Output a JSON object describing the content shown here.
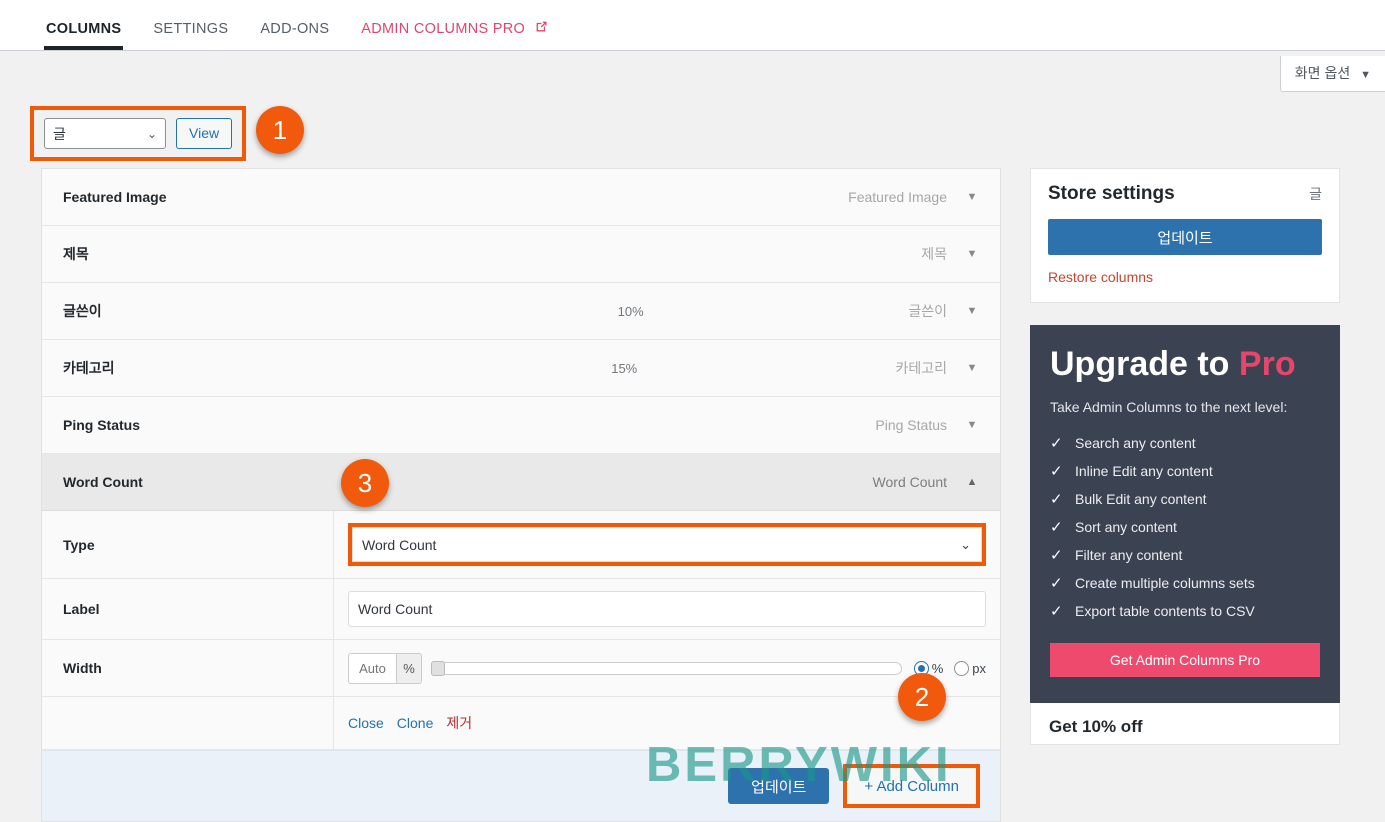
{
  "tabs": [
    {
      "label": "COLUMNS",
      "active": true
    },
    {
      "label": "SETTINGS",
      "active": false
    },
    {
      "label": "ADD-ONS",
      "active": false
    },
    {
      "label": "ADMIN COLUMNS PRO",
      "active": false,
      "external": true
    }
  ],
  "screen_options": {
    "label": "화면 옵션",
    "caret": "▼"
  },
  "selector": {
    "post_type_value": "글",
    "view_button": "View",
    "dropdown_arrow": "⌄"
  },
  "badges": {
    "one": "1",
    "two": "2",
    "three": "3"
  },
  "columns": [
    {
      "label": "Featured Image",
      "width": "",
      "type": "Featured Image",
      "toggle": "▼",
      "expanded": false
    },
    {
      "label": "제목",
      "width": "",
      "type": "제목",
      "toggle": "▼",
      "expanded": false
    },
    {
      "label": "글쓴이",
      "width": "10%",
      "type": "글쓴이",
      "toggle": "▼",
      "expanded": false
    },
    {
      "label": "카테고리",
      "width": "15%",
      "type": "카테고리",
      "toggle": "▼",
      "expanded": false
    },
    {
      "label": "Ping Status",
      "width": "",
      "type": "Ping Status",
      "toggle": "▼",
      "expanded": false
    },
    {
      "label": "Word Count",
      "width": "",
      "type": "Word Count",
      "toggle": "▲",
      "expanded": true
    }
  ],
  "settings_form": {
    "type_label": "Type",
    "type_value": "Word Count",
    "type_arrow": "⌄",
    "label_label": "Label",
    "label_value": "Word Count",
    "label_placeholder": "Word Count",
    "width_label": "Width",
    "width_value": "Auto",
    "width_placeholder": "Auto",
    "width_unit": "%",
    "unit_percent": "%",
    "unit_px": "px",
    "selected_unit": "%",
    "links": {
      "close": "Close",
      "clone": "Clone",
      "remove": "제거"
    }
  },
  "footer": {
    "update_label": "업데이트",
    "add_column_label": "+ Add Column"
  },
  "sidebar": {
    "store": {
      "title": "Store settings",
      "post_type": "글",
      "update_label": "업데이트",
      "restore_label": "Restore columns"
    },
    "pro": {
      "title_main": "Upgrade to",
      "title_accent": "Pro",
      "subtitle": "Take Admin Columns to the next level:",
      "check_glyph": "✓",
      "features": [
        "Search any content",
        "Inline Edit any content",
        "Bulk Edit any content",
        "Sort any content",
        "Filter any content",
        "Create multiple columns sets",
        "Export table contents to CSV"
      ],
      "cta_label": "Get Admin Columns Pro"
    },
    "bottom_partial": "Get 10% off"
  },
  "watermark": {
    "text": "BERRYWIKI"
  },
  "colors": {
    "highlight_orange": "#ef5a09",
    "badge_orange": "#f15a0c",
    "primary_blue": "#2e72ad",
    "link_blue": "#2271b1",
    "pro_pink": "#e8456b",
    "pro_dark": "#3b4251",
    "remove_red": "#b32d2e",
    "restore_red": "#c9442f",
    "watermark_teal": "#199687"
  }
}
